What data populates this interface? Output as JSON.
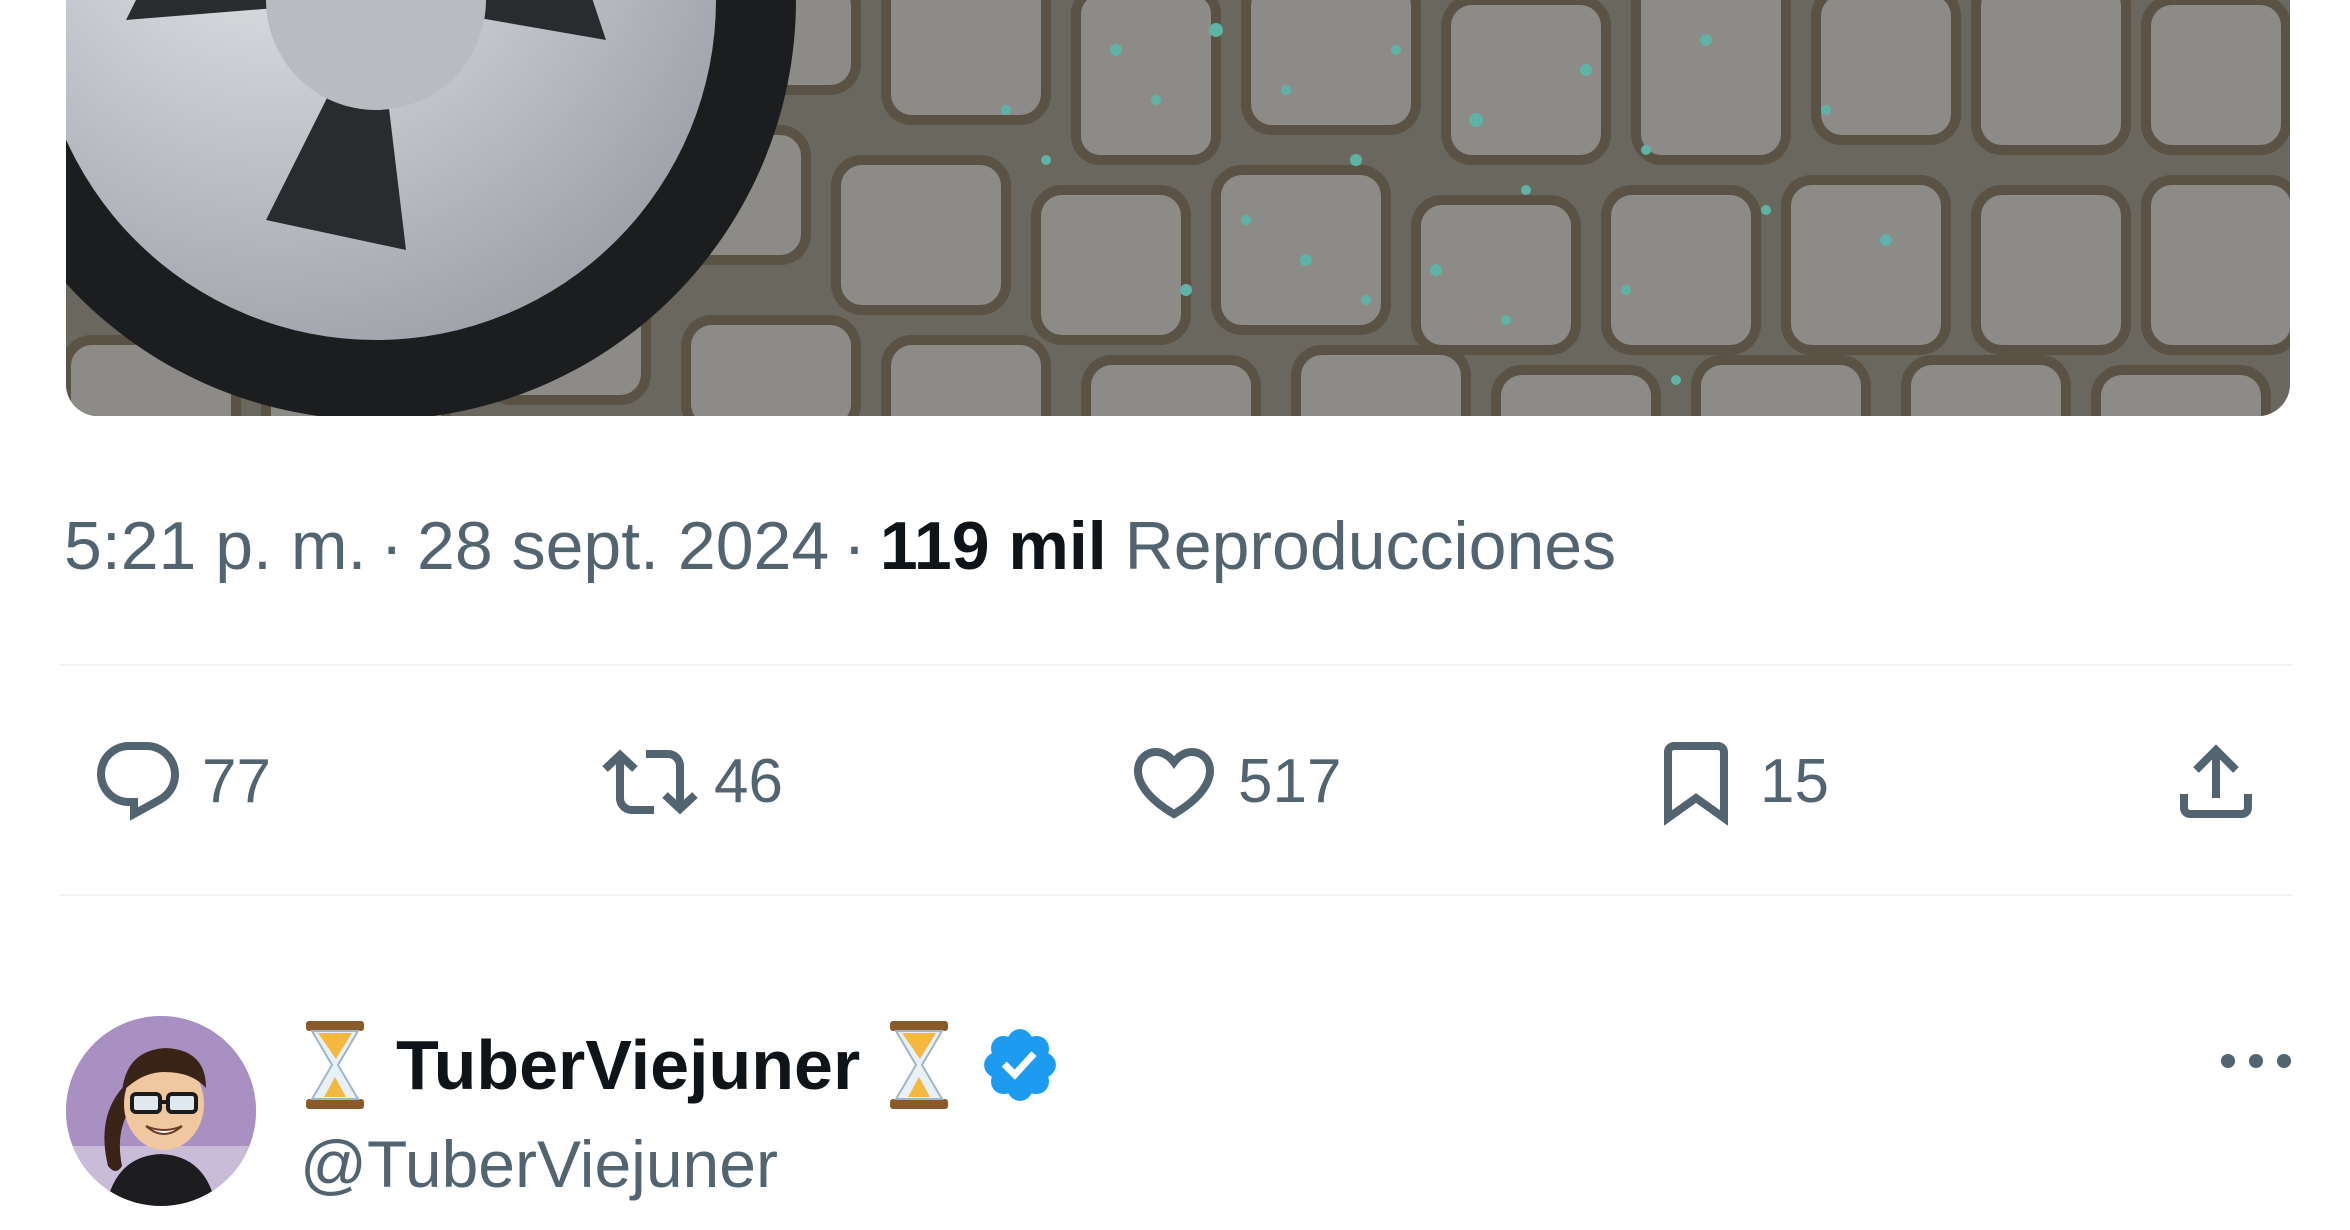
{
  "tweet": {
    "time": "5:21 p. m.",
    "separator": "·",
    "date": "28 sept. 2024",
    "views_count": "119 mil",
    "views_label": "Reproducciones",
    "photo_icon": "photo-of-car-wheel-on-cobblestones-with-broken-glass"
  },
  "actions": {
    "replies": "77",
    "retweets": "46",
    "likes": "517",
    "bookmarks": "15",
    "reply_icon": "speech-bubble-icon",
    "retweet_icon": "retweet-icon",
    "like_icon": "heart-icon",
    "bookmark_icon": "bookmark-icon",
    "share_icon": "share-upload-icon"
  },
  "next_author": {
    "display_name": "TuberViejuner",
    "emoji": "⏳",
    "handle": "@TuberViejuner",
    "verified": true,
    "more_icon": "more-horizontal-icon"
  },
  "colors": {
    "text_primary": "#0f1419",
    "text_secondary": "#536471",
    "divider": "#eff3f4",
    "verified_blue": "#1d9bf0"
  }
}
